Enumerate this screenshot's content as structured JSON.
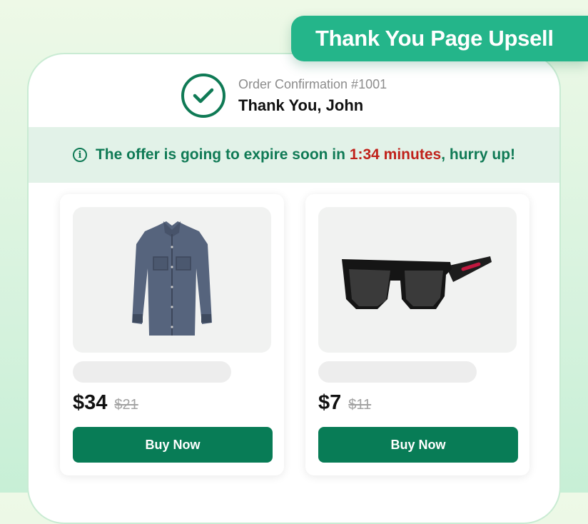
{
  "header": {
    "badge_title": "Thank You Page Upsell"
  },
  "confirmation": {
    "order_label": "Order Confirmation #1001",
    "greeting": "Thank You, John"
  },
  "banner": {
    "text_before": "The offer is going to expire soon in ",
    "timer": "1:34 minutes",
    "text_after": ", hurry up!"
  },
  "products": [
    {
      "image": "shirt",
      "price": "$34",
      "original_price": "$21",
      "button_label": "Buy Now"
    },
    {
      "image": "sunglasses",
      "price": "$7",
      "original_price": "$11",
      "button_label": "Buy Now"
    }
  ],
  "colors": {
    "brand_green": "#087c56",
    "accent_teal": "#24b58a",
    "timer_red": "#c0211a",
    "banner_bg": "#e2f2e8"
  }
}
